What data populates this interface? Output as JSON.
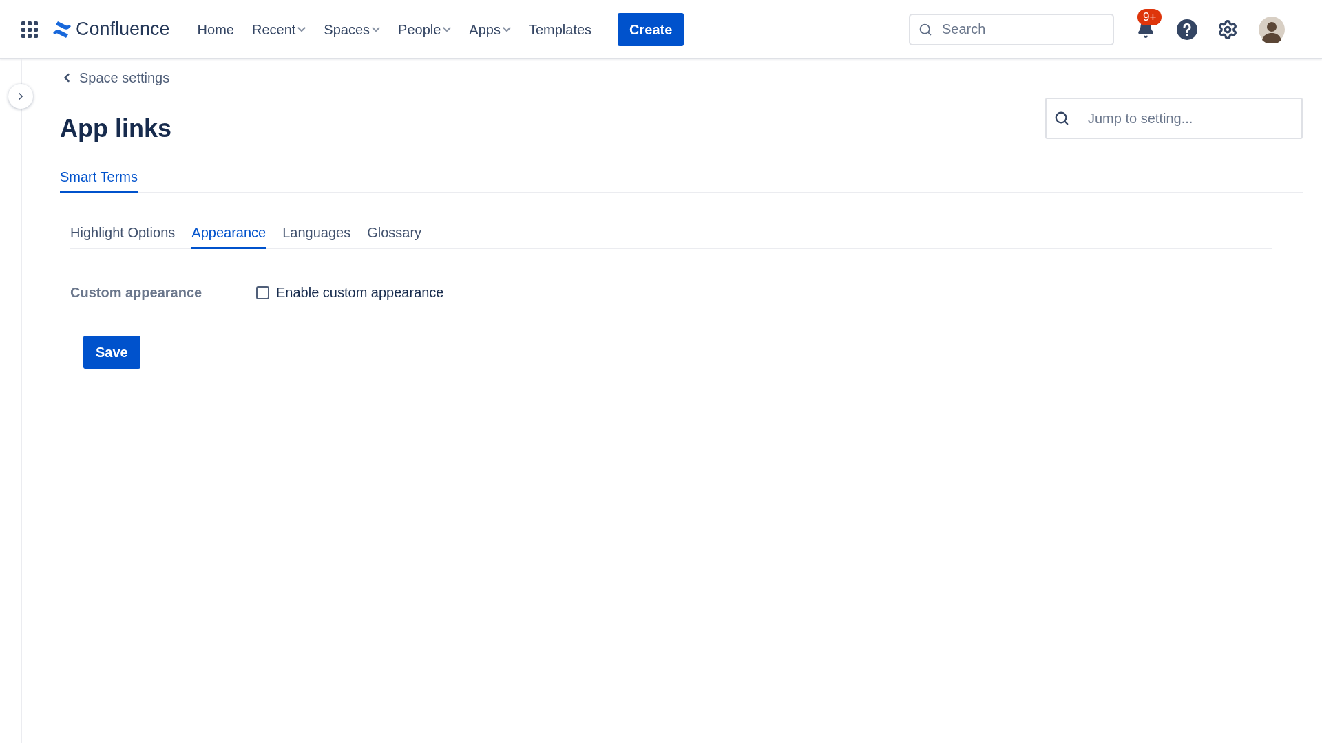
{
  "header": {
    "product": "Confluence",
    "nav": [
      {
        "label": "Home",
        "kind": "link"
      },
      {
        "label": "Recent",
        "kind": "dropdown"
      },
      {
        "label": "Spaces",
        "kind": "dropdown"
      },
      {
        "label": "People",
        "kind": "dropdown"
      },
      {
        "label": "Apps",
        "kind": "dropdown"
      },
      {
        "label": "Templates",
        "kind": "link"
      }
    ],
    "create_button": "Create",
    "search": {
      "placeholder": "Search"
    },
    "notifications_badge": "9+"
  },
  "breadcrumb": "Space settings",
  "title": "App links",
  "jump_field": {
    "placeholder": "Jump to setting..."
  },
  "tabs": [
    {
      "label": "Smart Terms",
      "selected": true
    }
  ],
  "subtabs": [
    {
      "label": "Highlight Options",
      "selected": false
    },
    {
      "label": "Appearance",
      "selected": true
    },
    {
      "label": "Languages",
      "selected": false
    },
    {
      "label": "Glossary",
      "selected": false
    }
  ],
  "form": {
    "label": "Custom appearance",
    "checkbox": {
      "label": "Enable custom appearance",
      "checked": false
    }
  },
  "save_button": "Save"
}
